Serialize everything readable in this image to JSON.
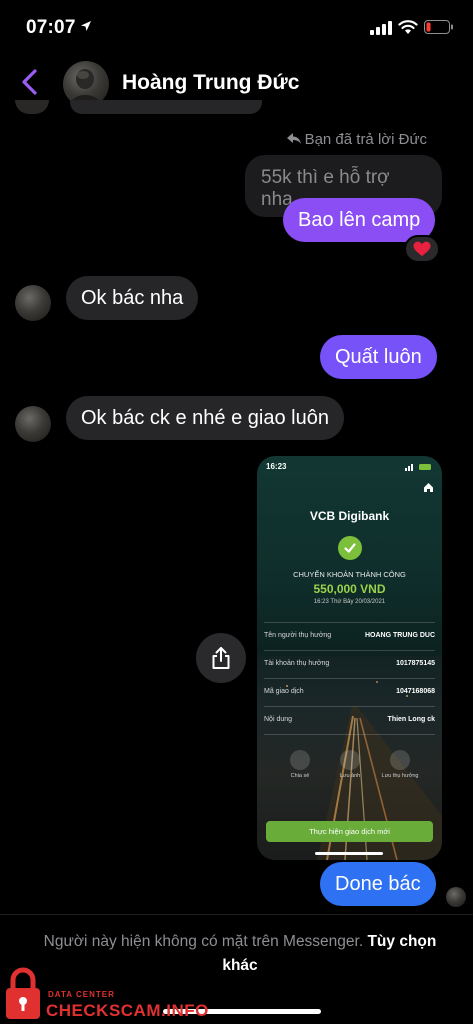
{
  "status_bar": {
    "time": "07:07"
  },
  "header": {
    "contact_name": "Hoàng Trung Đức"
  },
  "messages": {
    "reply_note": "Bạn đã trả lời Đức",
    "quoted": "55k thì e hỗ trợ nha",
    "out_1": "Bao lên camp",
    "in_1": "Ok bác nha",
    "out_2": "Quất luôn",
    "in_2": "Ok bác ck e nhé e giao luôn",
    "out_3": "Done bác"
  },
  "receipt": {
    "time": "16:23",
    "brand": "VCB Digibank",
    "status_title": "CHUYỂN KHOẢN THÀNH CÔNG",
    "amount": "550,000 VND",
    "datetime": "16:23 Thứ Bảy 20/03/2021",
    "rows": [
      {
        "label": "Tên người thụ hưởng",
        "value": "HOANG TRUNG DUC"
      },
      {
        "label": "Tài khoản thụ hưởng",
        "value": "1017875145"
      },
      {
        "label": "Mã giao dịch",
        "value": "1047168068"
      },
      {
        "label": "Nội dung",
        "value": "Thien Long ck"
      }
    ],
    "actions": [
      "Chia sẻ",
      "Lưu ảnh",
      "Lưu thụ hưởng"
    ],
    "cta": "Thực hiện giao dịch mới"
  },
  "footer": {
    "note": "Người này hiện không có mặt trên Messenger.",
    "link": "Tùy chọn khác"
  },
  "watermark": {
    "top": "DATA CENTER",
    "main": "CHECKSCAM.INFO"
  },
  "colors": {
    "accent_purple": "#8b4ef5",
    "accent_blue": "#2e71f2",
    "bubble_in": "#262628",
    "vcb_green": "#6aac3a"
  }
}
